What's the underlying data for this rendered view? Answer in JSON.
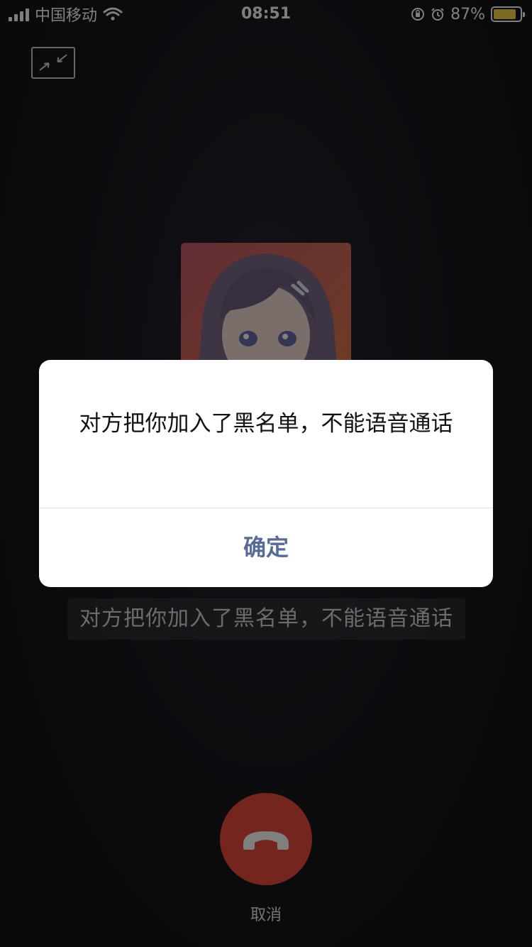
{
  "status_bar": {
    "carrier": "中国移动",
    "time": "08:51",
    "battery_percent": "87%",
    "battery_level": 0.87,
    "battery_color": "#f7d64a",
    "icons": [
      "signal-icon",
      "wifi-icon",
      "orientation-lock-icon",
      "alarm-icon",
      "battery-icon"
    ]
  },
  "call": {
    "status_text": "对方把你加入了黑名单，不能语音通话",
    "hangup_label": "取消",
    "hangup_color": "#e84b3d"
  },
  "alert": {
    "message": "对方把你加入了黑名单，不能语音通话",
    "confirm_label": "确定",
    "confirm_color": "#576b95"
  }
}
